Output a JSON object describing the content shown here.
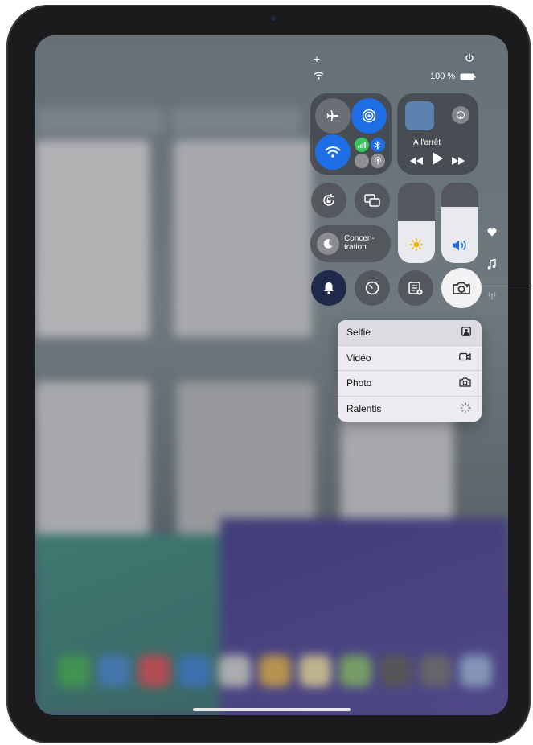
{
  "status": {
    "plus": "+",
    "battery": "100 %"
  },
  "now_playing": {
    "state": "À l'arrêt"
  },
  "focus": {
    "label_line1": "Concen-",
    "label_line2": "tration"
  },
  "levels": {
    "brightness": 0.52,
    "volume": 0.7
  },
  "camera_menu": {
    "items": [
      {
        "label": "Selfie",
        "icon": "selfie-portrait-icon"
      },
      {
        "label": "Vidéo",
        "icon": "video-camera-icon"
      },
      {
        "label": "Photo",
        "icon": "camera-icon"
      },
      {
        "label": "Ralentis",
        "icon": "slo-mo-icon"
      }
    ]
  },
  "colors": {
    "accent_blue": "#1e6fe6",
    "cellular_green": "#34c759"
  }
}
